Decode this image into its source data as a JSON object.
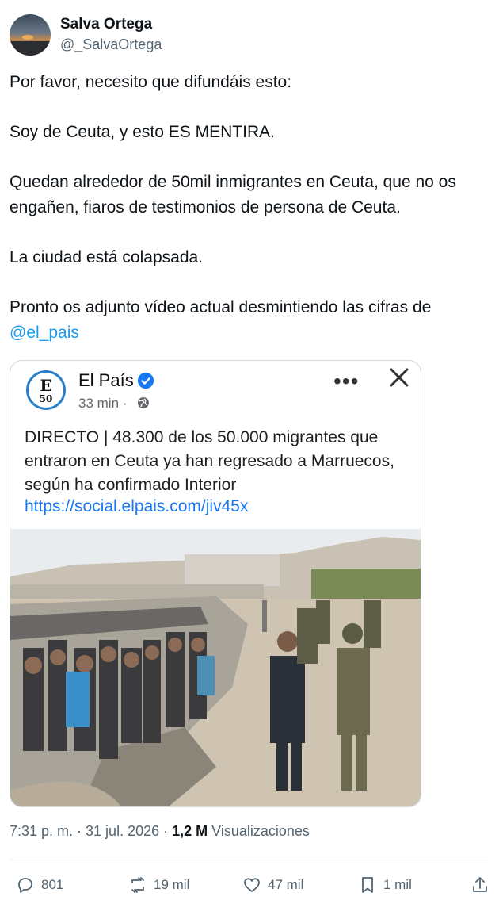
{
  "author": {
    "name": "Salva Ortega",
    "handle": "@_SalvaOrtega"
  },
  "post": {
    "line1": "Por favor, necesito que difundáis esto:",
    "line2": "Soy de Ceuta, y esto ES MENTIRA.",
    "line3": "Quedan alrededor de 50mil inmigrantes en Ceuta, que no os engañen, fiaros de testimonios de persona de Ceuta.",
    "line4": "La ciudad está colapsada.",
    "line5": "Pronto os adjunto vídeo actual desmintiendo las cifras de",
    "mention": "@el_pais"
  },
  "embedded": {
    "logo_letter": "E",
    "logo_number": "50",
    "source_name": "El País",
    "time": "33 min ·",
    "text": "DIRECTO | 48.300 de los 50.000 migrantes que entraron en Ceuta ya han regresado a Marruecos, según ha confirmado Interior",
    "link": "https://social.elpais.com/jiv45x",
    "more_label": "•••"
  },
  "meta": {
    "timestamp": "7:31 p. m. · 31 jul. 2026 ·",
    "views_count": "1,2 M",
    "views_label": "Visualizaciones"
  },
  "actions": {
    "replies": "801",
    "reposts": "19 mil",
    "likes": "47 mil",
    "bookmarks": "1 mil"
  },
  "colors": {
    "accent": "#1d9bf0",
    "muted": "#536471",
    "fb_link": "#1877f2"
  }
}
